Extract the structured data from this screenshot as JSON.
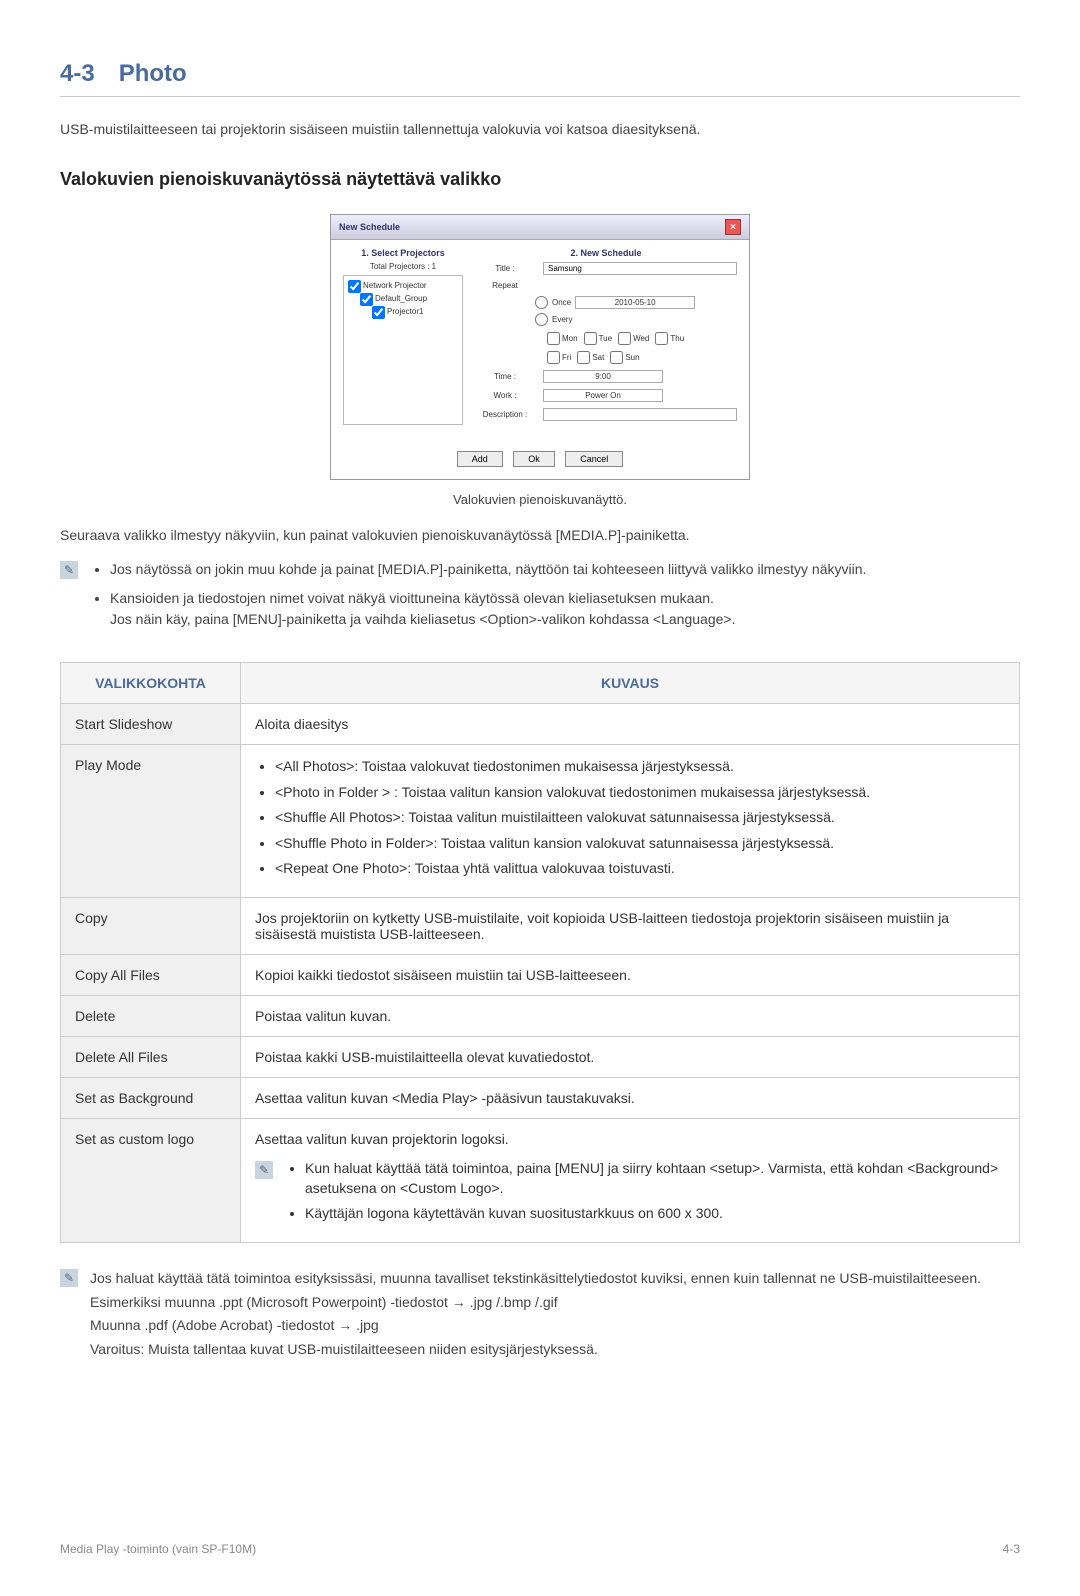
{
  "header": {
    "section_num": "4-3",
    "section_title": "Photo"
  },
  "intro": "USB-muistilaitteeseen tai projektorin sisäiseen muistiin tallennettuja valokuvia voi katsoa diaesityksenä.",
  "subheading": "Valokuvien pienoiskuvanäytössä näytettävä valikko",
  "dialog": {
    "title": "New Schedule",
    "left_header": "1. Select Projectors",
    "total_label": "Total Projectors :",
    "total_value": "1",
    "tree": {
      "root": "Network Projector",
      "group": "Default_Group",
      "item": "Projector1"
    },
    "right_header": "2. New Schedule",
    "title_label": "Title :",
    "title_value": "Samsung",
    "repeat_label": "Repeat",
    "once": "Once",
    "every": "Every",
    "date_value": "2010-05-10",
    "days": [
      "Mon",
      "Tue",
      "Wed",
      "Thu",
      "Fri",
      "Sat",
      "Sun"
    ],
    "time_label": "Time :",
    "time_value": "9:00",
    "work_label": "Work :",
    "work_value": "Power On",
    "desc_label": "Description :",
    "btn_add": "Add",
    "btn_ok": "Ok",
    "btn_cancel": "Cancel"
  },
  "caption": "Valokuvien pienoiskuvanäyttö.",
  "para1": "Seuraava valikko ilmestyy näkyviin, kun painat valokuvien pienoiskuvanäytössä [MEDIA.P]-painiketta.",
  "notes1": [
    "Jos näytössä on jokin muu kohde ja painat [MEDIA.P]-painiketta, näyttöön tai kohteeseen liittyvä valikko ilmestyy näkyviin.",
    "Kansioiden ja tiedostojen nimet voivat näkyä vioittuneina käytössä olevan kieliasetuksen mukaan.\nJos näin käy, paina [MENU]-painiketta ja vaihda kieliasetus <Option>-valikon kohdassa <Language>."
  ],
  "table": {
    "head1": "VALIKKOKOHTA",
    "head2": "KUVAUS",
    "rows": [
      {
        "k": "Start Slideshow",
        "v": "Aloita diaesitys"
      },
      {
        "k": "Play Mode",
        "bullets": [
          "<All Photos>: Toistaa valokuvat tiedostonimen mukaisessa järjestyksessä.",
          "<Photo in Folder > : Toistaa valitun kansion valokuvat tiedostonimen mukaisessa järjestyksessä.",
          "<Shuffle All Photos>: Toistaa valitun muistilaitteen valokuvat satunnaisessa järjestyksessä.",
          "<Shuffle Photo in Folder>: Toistaa valitun kansion valokuvat satunnaisessa järjestyksessä.",
          "<Repeat One Photo>: Toistaa yhtä valittua valokuvaa toistuvasti."
        ]
      },
      {
        "k": "Copy",
        "v": "Jos projektoriin on kytketty USB-muistilaite, voit kopioida USB-laitteen tiedostoja projektorin sisäiseen muistiin ja sisäisestä muistista USB-laitteeseen."
      },
      {
        "k": "Copy All Files",
        "v": "Kopioi kaikki tiedostot sisäiseen muistiin tai USB-laitteeseen."
      },
      {
        "k": "Delete",
        "v": "Poistaa valitun kuvan."
      },
      {
        "k": "Delete All Files",
        "v": "Poistaa kakki USB-muistilaitteella olevat kuvatiedostot."
      },
      {
        "k": "Set as Background",
        "v": "Asettaa valitun kuvan <Media Play> -pääsivun taustakuvaksi."
      },
      {
        "k": "Set as custom logo",
        "v": "Asettaa valitun kuvan projektorin logoksi.",
        "note_bullets": [
          "Kun haluat käyttää tätä toimintoa, paina [MENU] ja siirry kohtaan <setup>. Varmista, että kohdan <Background> asetuksena on <Custom Logo>.",
          "Käyttäjän logona käytettävän kuvan suositustarkkuus on 600 x 300."
        ]
      }
    ]
  },
  "footer_note": {
    "p1": "Jos haluat käyttää tätä toimintoa esityksissäsi, muunna tavalliset tekstinkäsittelytiedostot kuviksi, ennen kuin tallennat ne USB-muistilaitteeseen.",
    "p2": "Esimerkiksi muunna .ppt (Microsoft Powerpoint) -tiedostot → .jpg /.bmp /.gif",
    "p3": "Muunna .pdf (Adobe Acrobat) -tiedostot → .jpg",
    "p4": "Varoitus: Muista tallentaa kuvat USB-muistilaitteeseen niiden esitysjärjestyksessä."
  },
  "footer": {
    "left": "Media Play -toiminto (vain SP-F10M)",
    "right": "4-3"
  }
}
